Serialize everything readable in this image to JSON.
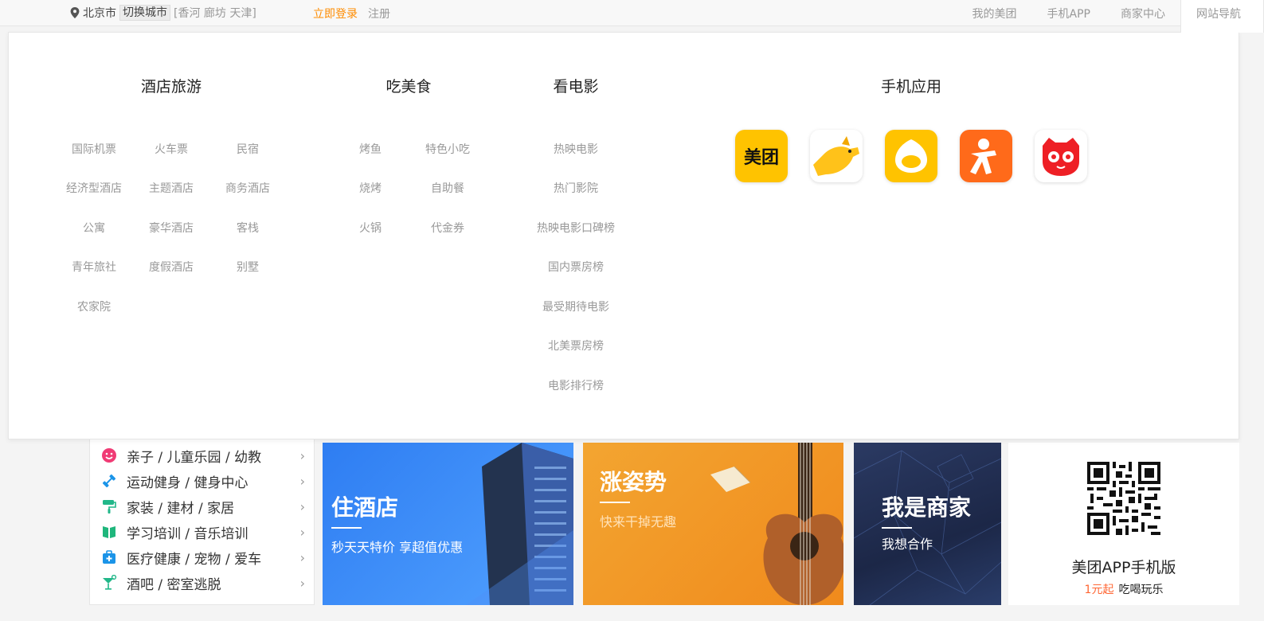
{
  "topbar": {
    "city": "北京市",
    "switch_city": "切换城市",
    "nearby": "[香河 廊坊 天津]",
    "login": "立即登录",
    "register": "注册",
    "nav": [
      "我的美团",
      "手机APP",
      "商家中心",
      "网站导航"
    ]
  },
  "dropdown": {
    "sections": [
      {
        "title": "酒店旅游",
        "links": [
          "国际机票",
          "火车票",
          "民宿",
          "经济型酒店",
          "主题酒店",
          "商务酒店",
          "公寓",
          "豪华酒店",
          "客栈",
          "青年旅社",
          "度假酒店",
          "别墅",
          "农家院"
        ]
      },
      {
        "title": "吃美食",
        "links": [
          "烤鱼",
          "特色小吃",
          "烧烤",
          "自助餐",
          "火锅",
          "代金券"
        ]
      },
      {
        "title": "看电影",
        "links": [
          "热映电影",
          "热门影院",
          "热映电影口碑榜",
          "国内票房榜",
          "最受期待电影",
          "北美票房榜",
          "电影排行榜"
        ]
      },
      {
        "title": "手机应用",
        "apps": [
          {
            "name": "meituan-app-icon",
            "label": "美团",
            "color": "#ffc300"
          },
          {
            "name": "dog-app-icon",
            "color": "#ffffff"
          },
          {
            "name": "drop-app-icon",
            "color": "#ffc300"
          },
          {
            "name": "dianping-app-icon",
            "color": "#ff6a1a"
          },
          {
            "name": "maoyan-app-icon",
            "color": "#ffffff"
          }
        ]
      }
    ]
  },
  "categories": [
    {
      "label": "亲子 / 儿童乐园 / 幼教",
      "icon": "kid-icon",
      "color": "#f03b75"
    },
    {
      "label": "运动健身 / 健身中心",
      "icon": "dumbbell-icon",
      "color": "#1b94e8"
    },
    {
      "label": "家装 / 建材 / 家居",
      "icon": "paint-roller-icon",
      "color": "#21b789"
    },
    {
      "label": "学习培训 / 音乐培训",
      "icon": "book-icon",
      "color": "#1fb67c"
    },
    {
      "label": "医疗健康 / 宠物 / 爱车",
      "icon": "medkit-icon",
      "color": "#1b94e8"
    },
    {
      "label": "酒吧 / 密室逃脱",
      "icon": "cocktail-icon",
      "color": "#21b789"
    }
  ],
  "banners": [
    {
      "title": "住酒店",
      "subtitle": "秒天天特价 享超值优惠"
    },
    {
      "title": "涨姿势",
      "subtitle": "快来干掉无趣"
    },
    {
      "title": "我是商家",
      "subtitle": "我想合作"
    }
  ],
  "qr": {
    "title": "美团APP手机版",
    "price": "1元起",
    "slogan": "吃喝玩乐"
  },
  "colors": {
    "accent": "#fe8c00",
    "red": "#ff6633"
  }
}
